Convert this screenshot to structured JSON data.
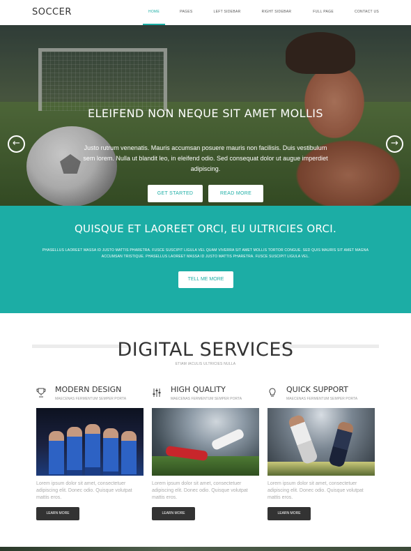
{
  "nav": {
    "logo": "SOCCER",
    "items": [
      "HOME",
      "PAGES",
      "LEFT SIDEBAR",
      "RIGHT SIDEBAR",
      "FULL PAGE",
      "CONTACT US"
    ],
    "active_index": 0
  },
  "hero": {
    "title": "ELEIFEND NON NEQUE SIT AMET MOLLIS",
    "text": "Justo rutrum venenatis. Mauris accumsan posuere mauris non facilisis. Duis vestibulum sem lorem. Nulla ut blandit leo, in eleifend odio. Sed consequat dolor ut augue imperdiet adipiscing.",
    "btn_primary": "GET STARTED",
    "btn_secondary": "READ MORE",
    "prev_icon": "arrow-left-circle-icon",
    "next_icon": "arrow-right-circle-icon"
  },
  "band": {
    "title": "QUISQUE ET LAOREET ORCI, EU ULTRICIES ORCI.",
    "text": "PHASELLUS LAOREET MASSA ID JUSTO MATTIS PHARETRA. FUSCE SUSCIPIT LIGULA VEL QUAM VIVERRA SIT AMET MOLLIS TORTOR CONGUE. SED QUIS MAURIS SIT AMET MAGNA ACCUMSAN TRISTIQUE. PHASELLUS LAOREET MASSA ID JUSTO MATTIS PHARETRA. FUSCE SUSCIPIT LIGULA VEL.",
    "button": "TELL ME MORE",
    "color": "#1cada5"
  },
  "services": {
    "heading": "DIGITAL SERVICES",
    "subheading": "ETIAM IACULIS ULTRICIES NULLA",
    "cards": [
      {
        "title": "MODERN DESIGN",
        "subtitle": "MAECENAS FERMENTUM SEMPER PORTA",
        "icon": "trophy-icon",
        "text": "Lorem ipsum dolor sit amet, consectetuer adipiscing elit. Donec odio. Quisque volutpat mattis eros.",
        "button": "LEARN MORE"
      },
      {
        "title": "HIGH QUALITY",
        "subtitle": "MAECENAS FERMENTUM SEMPER PORTA",
        "icon": "sliders-icon",
        "text": "Lorem ipsum dolor sit amet, consectetuer adipiscing elit. Donec odio. Quisque volutpat mattis eros.",
        "button": "LEARN MORE"
      },
      {
        "title": "QUICK SUPPORT",
        "subtitle": "MAECENAS FERMENTUM SEMPER PORTA",
        "icon": "lightbulb-icon",
        "text": "Lorem ipsum dolor sit amet, consectetuer adipiscing elit. Donec odio. Quisque volutpat mattis eros.",
        "button": "LEARN MORE"
      }
    ]
  }
}
